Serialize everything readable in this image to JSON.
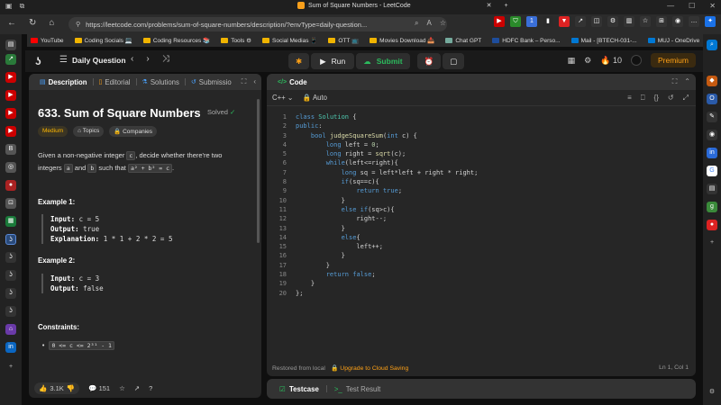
{
  "browser": {
    "tab_title": "Sum of Square Numbers - LeetCode",
    "url": "https://leetcode.com/problems/sum-of-square-numbers/description/?envType=daily-question...",
    "window_controls": [
      "—",
      "☐",
      "✕"
    ]
  },
  "bookmarks": [
    {
      "label": "YouTube",
      "color": "#ff0000"
    },
    {
      "label": "Coding Socials 💻",
      "color": "#f0b400"
    },
    {
      "label": "Coding Resources 📚",
      "color": "#f0b400"
    },
    {
      "label": "Tools ⚙",
      "color": "#f0b400"
    },
    {
      "label": "Social Medias 📱",
      "color": "#f0b400"
    },
    {
      "label": "OTT 📺",
      "color": "#f0b400"
    },
    {
      "label": "Movies Download 📥",
      "color": "#f0b400"
    },
    {
      "label": "Chat GPT",
      "color": "#74aa9c"
    },
    {
      "label": "HDFC Bank – Perso...",
      "color": "#1e4d9c"
    },
    {
      "label": "Mail - [BTECH-031-...",
      "color": "#0078d4"
    },
    {
      "label": "MUJ - OneDrive",
      "color": "#0078d4"
    }
  ],
  "header": {
    "daily_label": "Daily Question",
    "run_label": "Run",
    "submit_label": "Submit",
    "streak": "10",
    "premium_label": "Premium"
  },
  "left_panel": {
    "tabs": [
      "Description",
      "Editorial",
      "Solutions",
      "Submissio"
    ],
    "title": "633. Sum of Square Numbers",
    "solved_label": "Solved",
    "chips": [
      "Medium",
      "Topics",
      "Companies"
    ],
    "desc_1": "Given a non-negative integer",
    "desc_c": "c",
    "desc_2": ", decide whether there're two",
    "desc_3": "integers",
    "desc_a": "a",
    "desc_and": "and",
    "desc_b": "b",
    "desc_4": "such that",
    "desc_eq": "a² + b² = c",
    "desc_end": ".",
    "example1_h": "Example 1:",
    "ex1_input_k": "Input:",
    "ex1_input_v": "c = 5",
    "ex1_output_k": "Output:",
    "ex1_output_v": "true",
    "ex1_expl_k": "Explanation:",
    "ex1_expl_v": "1 * 1 + 2 * 2 = 5",
    "example2_h": "Example 2:",
    "ex2_input_k": "Input:",
    "ex2_input_v": "c = 3",
    "ex2_output_k": "Output:",
    "ex2_output_v": "false",
    "constraints_h": "Constraints:",
    "constraint_1": "0 <= c <= 2³¹ - 1",
    "likes": "3.1K",
    "comments": "151"
  },
  "code_panel": {
    "tab_label": "Code",
    "language": "C++",
    "mode": "Auto",
    "line_numbers": [
      "1",
      "2",
      "3",
      "4",
      "5",
      "6",
      "7",
      "8",
      "9",
      "10",
      "11",
      "12",
      "13",
      "14",
      "15",
      "16",
      "17",
      "18",
      "19",
      "20"
    ],
    "status_left": "Restored from local",
    "status_upgrade": "Upgrade to Cloud Saving",
    "status_pos": "Ln 1, Col 1"
  },
  "testcase": {
    "tab_1": "Testcase",
    "tab_2": "Test Result"
  }
}
